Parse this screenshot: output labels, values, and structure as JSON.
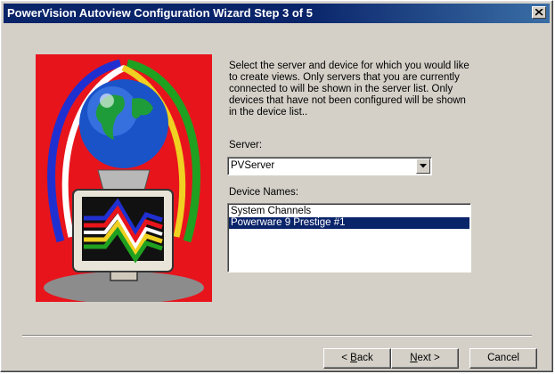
{
  "window": {
    "title": "PowerVision Autoview Configuration Wizard Step 3 of 5"
  },
  "instructions": "Select the server and device for which you would like to create views. Only servers that you are currently connected to will be shown in the server list. Only devices that have not been configured will be shown in the device list..",
  "server": {
    "label": "Server:",
    "selected": "PVServer"
  },
  "devices": {
    "label": "Device Names:",
    "items": [
      "System Channels",
      "Powerware 9 Prestige #1"
    ],
    "selected_index": 1
  },
  "buttons": {
    "back_prefix": "< ",
    "back_mnemonic": "B",
    "back_rest": "ack",
    "next_mnemonic": "N",
    "next_rest": "ext >",
    "cancel": "Cancel"
  },
  "colors": {
    "titlebar": "#0a246a",
    "dialog_bg": "#d4d0c8",
    "selection": "#0a246a"
  }
}
